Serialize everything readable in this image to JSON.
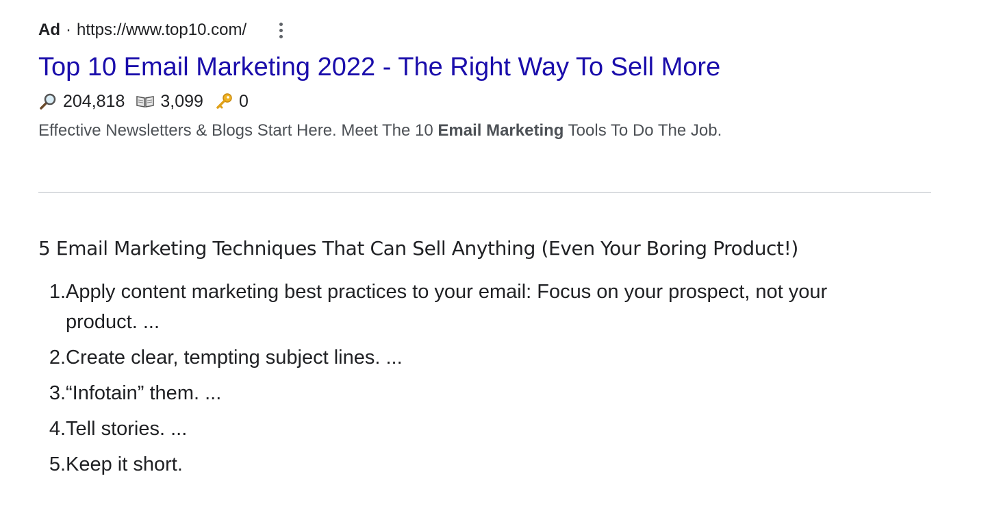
{
  "ad": {
    "label": "Ad",
    "separator": "·",
    "url": "https://www.top10.com/",
    "more_icon": "more-vertical-icon",
    "title": "Top 10 Email Marketing 2022 - The Right Way To Sell More",
    "stats": [
      {
        "icon": "magnifier-icon",
        "value": "204,818"
      },
      {
        "icon": "open-book-icon",
        "value": "3,099"
      },
      {
        "icon": "key-icon",
        "value": "0"
      }
    ],
    "description": {
      "before": "Effective Newsletters & Blogs Start Here. Meet The 10 ",
      "bold": "Email Marketing",
      "after": " Tools To Do The Job."
    }
  },
  "snippet": {
    "heading": "5 Email Marketing Techniques That Can Sell Anything (Even Your Boring Product!)",
    "items": [
      {
        "number": "1.",
        "text": "Apply content marketing best practices to your email: Focus on your prospect, not your product. ..."
      },
      {
        "number": "2.",
        "text": "Create clear, tempting subject lines. ..."
      },
      {
        "number": "3.",
        "text": "“Infotain” them. ..."
      },
      {
        "number": "4.",
        "text": "Tell stories. ..."
      },
      {
        "number": "5.",
        "text": "Keep it short."
      }
    ]
  },
  "colors": {
    "title_link": "#1a0dab",
    "text": "#202124",
    "description": "#4d5156",
    "divider": "#dadce0"
  }
}
